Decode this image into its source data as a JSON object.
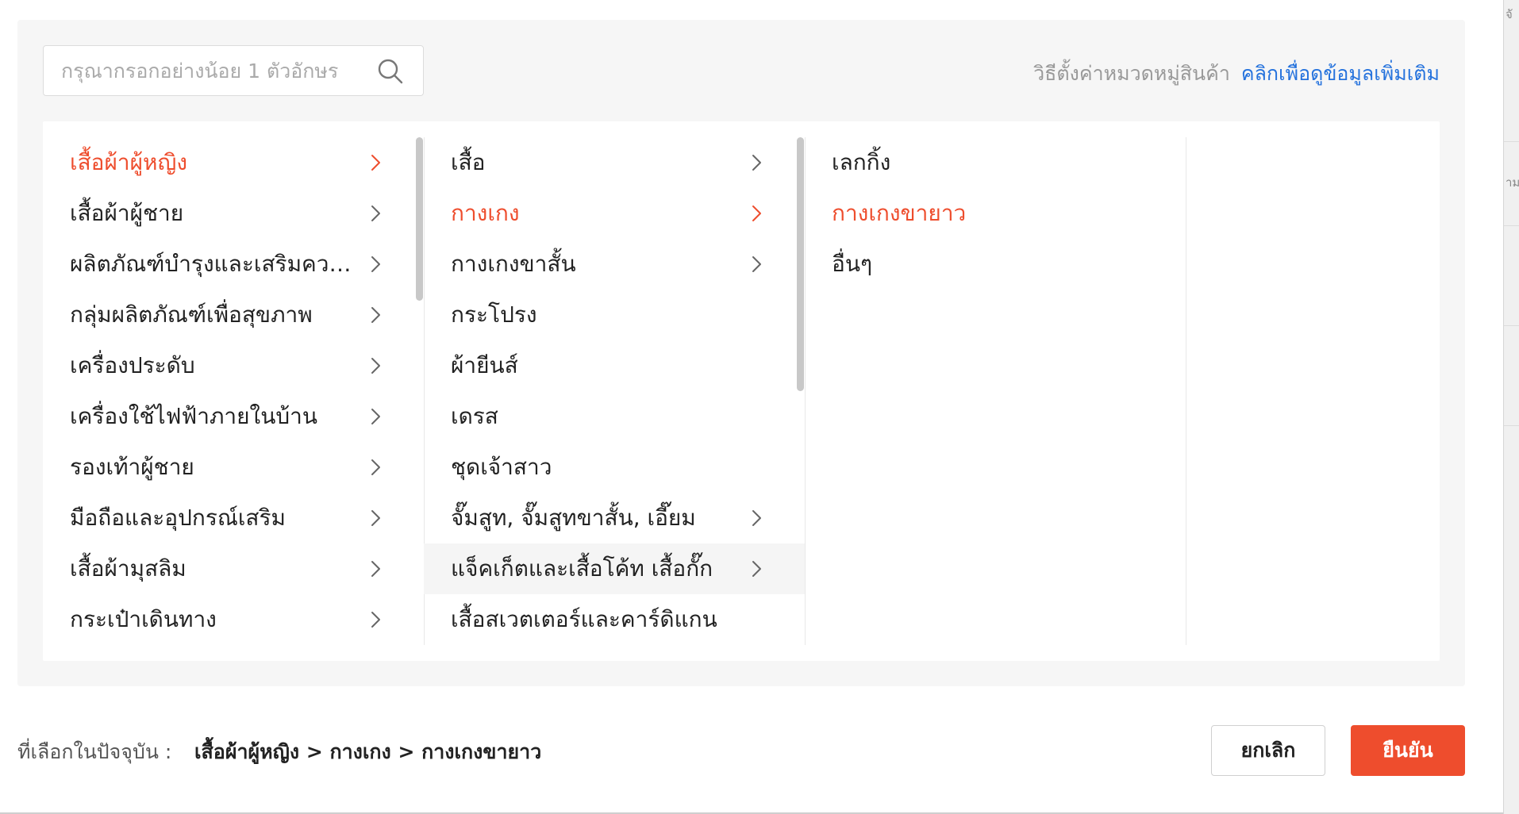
{
  "search": {
    "placeholder": "กรุณากรอกอย่างน้อย 1 ตัวอักษร",
    "value": ""
  },
  "help": {
    "text": "วิธีตั้งค่าหมวดหมู่สินค้า",
    "link": "คลิกเพื่อดูข้อมูลเพิ่มเติม"
  },
  "columns": {
    "level1": [
      {
        "label": "เสื้อผ้าผู้หญิง",
        "has_children": true,
        "state": "active"
      },
      {
        "label": "เสื้อผ้าผู้ชาย",
        "has_children": true,
        "state": "normal"
      },
      {
        "label": "ผลิตภัณฑ์บำรุงและเสริมความ...",
        "has_children": true,
        "state": "normal"
      },
      {
        "label": "กลุ่มผลิตภัณฑ์เพื่อสุขภาพ",
        "has_children": true,
        "state": "normal"
      },
      {
        "label": "เครื่องประดับ",
        "has_children": true,
        "state": "normal"
      },
      {
        "label": "เครื่องใช้ไฟฟ้าภายในบ้าน",
        "has_children": true,
        "state": "normal"
      },
      {
        "label": "รองเท้าผู้ชาย",
        "has_children": true,
        "state": "normal"
      },
      {
        "label": "มือถือและอุปกรณ์เสริม",
        "has_children": true,
        "state": "normal"
      },
      {
        "label": "เสื้อผ้ามุสลิม",
        "has_children": true,
        "state": "normal"
      },
      {
        "label": "กระเป๋าเดินทาง",
        "has_children": true,
        "state": "normal"
      }
    ],
    "level2": [
      {
        "label": "เสื้อ",
        "has_children": true,
        "state": "normal"
      },
      {
        "label": "กางเกง",
        "has_children": true,
        "state": "active"
      },
      {
        "label": "กางเกงขาสั้น",
        "has_children": true,
        "state": "normal"
      },
      {
        "label": "กระโปรง",
        "has_children": false,
        "state": "normal"
      },
      {
        "label": "ผ้ายีนส์",
        "has_children": false,
        "state": "normal"
      },
      {
        "label": "เดรส",
        "has_children": false,
        "state": "normal"
      },
      {
        "label": "ชุดเจ้าสาว",
        "has_children": false,
        "state": "normal"
      },
      {
        "label": "จั๊มสูท, จั๊มสูทขาสั้น, เอี๊ยม",
        "has_children": true,
        "state": "normal"
      },
      {
        "label": "แจ็คเก็ตและเสื้อโค้ท เสื้อกั๊ก",
        "has_children": true,
        "state": "hover"
      },
      {
        "label": "เสื้อสเวตเตอร์และคาร์ดิแกน",
        "has_children": false,
        "state": "normal"
      }
    ],
    "level3": [
      {
        "label": "เลกกิ้ง",
        "has_children": false,
        "state": "normal"
      },
      {
        "label": "กางเกงขายาว",
        "has_children": false,
        "state": "active"
      },
      {
        "label": "อื่นๆ",
        "has_children": false,
        "state": "normal"
      }
    ]
  },
  "footer": {
    "selected_label": "ที่เลือกในปัจจุบัน :",
    "selected_path": "เสื้อผ้าผู้หญิง > กางเกง > กางเกงขายาว",
    "cancel_label": "ยกเลิก",
    "confirm_label": "ยืนยัน"
  },
  "colors": {
    "accent": "#ee4d2d",
    "link": "#2673dd",
    "muted": "#999999"
  },
  "icons": {
    "search": "search-icon",
    "chevron": "chevron-right-icon"
  }
}
